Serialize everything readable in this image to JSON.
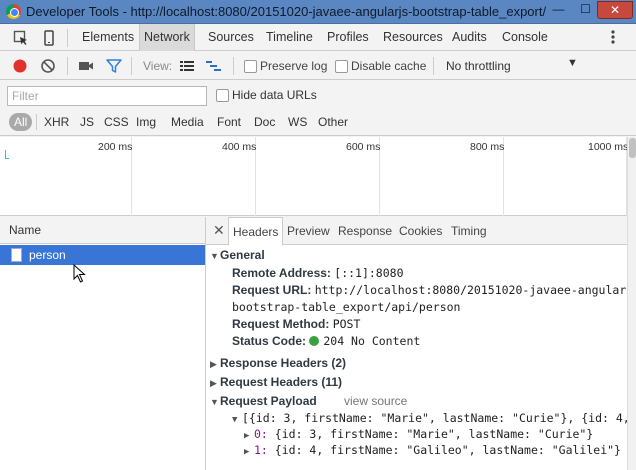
{
  "window": {
    "title": "Developer Tools - http://localhost:8080/20151020-javaee-angularjs-bootstrap-table_export/",
    "minimize": "—",
    "maximize": "☐",
    "close": "✕"
  },
  "main_tabs": [
    {
      "label": "Elements"
    },
    {
      "label": "Network",
      "selected": true
    },
    {
      "label": "Sources"
    },
    {
      "label": "Timeline"
    },
    {
      "label": "Profiles"
    },
    {
      "label": "Resources"
    },
    {
      "label": "Audits"
    },
    {
      "label": "Console"
    }
  ],
  "network_toolbar": {
    "view_label": "View:",
    "preserve_log": "Preserve log",
    "preserve_log_checked": false,
    "disable_cache": "Disable cache",
    "disable_cache_checked": false,
    "throttling": "No throttling",
    "record_color": "#e0312c"
  },
  "filter": {
    "placeholder": "Filter",
    "hide_data_urls": "Hide data URLs",
    "hide_data_urls_checked": false,
    "types": [
      "All",
      "XHR",
      "JS",
      "CSS",
      "Img",
      "Media",
      "Font",
      "Doc",
      "WS",
      "Other"
    ],
    "selected_type": "All"
  },
  "overview": {
    "ticks": [
      "200 ms",
      "400 ms",
      "600 ms",
      "800 ms",
      "1000 ms"
    ]
  },
  "request_list": {
    "header": "Name",
    "rows": [
      {
        "name": "person",
        "selected": true
      }
    ],
    "selection_color": "#3875d7"
  },
  "details": {
    "tabs": [
      "Headers",
      "Preview",
      "Response",
      "Cookies",
      "Timing"
    ],
    "selected_tab": "Headers",
    "general": {
      "title": "General",
      "remote_address_key": "Remote Address:",
      "remote_address": "[::1]:8080",
      "request_url_key": "Request URL:",
      "request_url_1": "http://localhost:8080/20151020-javaee-angularjs-",
      "request_url_2": "bootstrap-table_export/api/person",
      "request_method_key": "Request Method:",
      "request_method": "POST",
      "status_code_key": "Status Code:",
      "status_code": "204 No Content",
      "status_color": "#3ca041"
    },
    "response_headers": "Response Headers (2)",
    "request_headers": "Request Headers (11)",
    "request_payload": {
      "title": "Request Payload",
      "view_source": "view source",
      "summary": "[{id: 3, firstName: \"Marie\", lastName: \"Curie\"}, {id: 4, …",
      "items": [
        {
          "index": "0:",
          "value": "{id: 3, firstName: \"Marie\", lastName: \"Curie\"}"
        },
        {
          "index": "1:",
          "value": "{id: 4, firstName: \"Galileo\", lastName: \"Galilei\"}"
        }
      ]
    }
  }
}
